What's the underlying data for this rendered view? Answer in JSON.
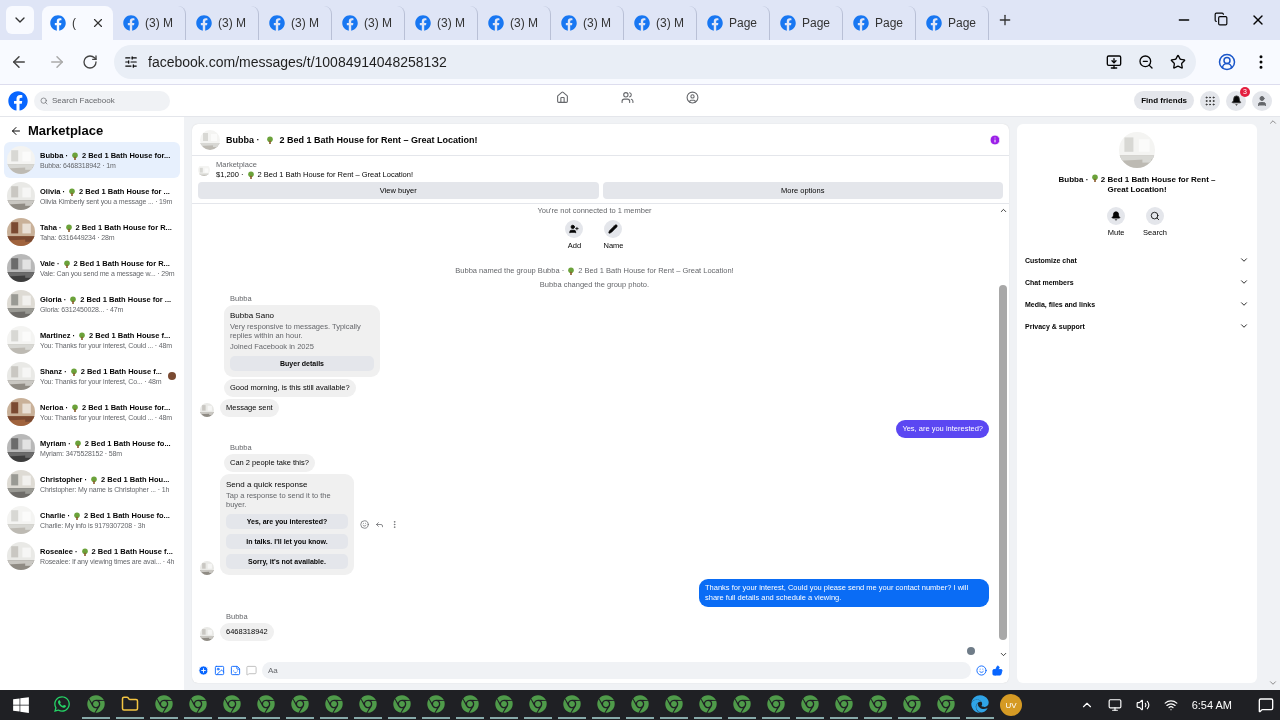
{
  "browser": {
    "tabs": [
      {
        "title": "(",
        "selected": true
      },
      {
        "title": "(3) M",
        "selected": false
      },
      {
        "title": "(3) M",
        "selected": false
      },
      {
        "title": "(3) M",
        "selected": false
      },
      {
        "title": "(3) M",
        "selected": false
      },
      {
        "title": "(3) M",
        "selected": false
      },
      {
        "title": "(3) M",
        "selected": false
      },
      {
        "title": "(3) M",
        "selected": false
      },
      {
        "title": "(3) M",
        "selected": false
      },
      {
        "title": "Page",
        "selected": false
      },
      {
        "title": "Page",
        "selected": false
      },
      {
        "title": "Page",
        "selected": false
      },
      {
        "title": "Page",
        "selected": false
      }
    ],
    "url": "facebook.com/messages/t/10084914048258132"
  },
  "header": {
    "search_placeholder": "Search Facebook",
    "find_friends": "Find friends",
    "notification_count": "3",
    "nav": [
      {
        "kind": "home"
      },
      {
        "kind": "friends"
      },
      {
        "kind": "groups"
      }
    ]
  },
  "sidebar": {
    "title": "Marketplace",
    "conversations": [
      {
        "name": "Bubba ·",
        "listing": "2 Bed 1 Bath House for...",
        "preview": "Bubba: 6468318942 · 1m",
        "selected": true,
        "seen": false
      },
      {
        "name": "Olivia ·",
        "listing": "2 Bed 1 Bath House for ...",
        "preview": "Olivia Kimberly sent you a message ... · 19m",
        "selected": false,
        "seen": false
      },
      {
        "name": "Taha ·",
        "listing": "2 Bed 1 Bath House for R...",
        "preview": "Taha: 6316449234 · 28m",
        "selected": false,
        "seen": false
      },
      {
        "name": "Vale ·",
        "listing": "2 Bed 1 Bath House for R...",
        "preview": "Vale: Can you send me a message w... · 29m",
        "selected": false,
        "seen": false
      },
      {
        "name": "Gloria ·",
        "listing": "2 Bed 1 Bath House for ...",
        "preview": "Gloria: 6312450028... · 47m",
        "selected": false,
        "seen": false
      },
      {
        "name": "Martinez ·",
        "listing": "2 Bed 1 Bath House f...",
        "preview": "You: Thanks for your interest, Could ... · 48m",
        "selected": false,
        "seen": false
      },
      {
        "name": "Shanz ·",
        "listing": "2 Bed 1 Bath House f...",
        "preview": "You: Thanks for your interest, Co... · 48m",
        "selected": false,
        "seen": true
      },
      {
        "name": "Nerioa ·",
        "listing": "2 Bed 1 Bath House for...",
        "preview": "You: Thanks for your interest, Could ... · 48m",
        "selected": false,
        "seen": false
      },
      {
        "name": "Myriam ·",
        "listing": "2 Bed 1 Bath House fo...",
        "preview": "Myriam: 3475528152 · 58m",
        "selected": false,
        "seen": false
      },
      {
        "name": "Christopher ·",
        "listing": "2 Bed 1 Bath Hou...",
        "preview": "Christopher: My name is Christopher ... · 1h",
        "selected": false,
        "seen": false
      },
      {
        "name": "Charlie ·",
        "listing": "2 Bed 1 Bath House fo...",
        "preview": "Charlie: My info is 9179307208 · 3h",
        "selected": false,
        "seen": false
      },
      {
        "name": "Rosealee ·",
        "listing": "2 Bed 1 Bath House f...",
        "preview": "Rosealee: If any viewing times are avai... · 4h",
        "selected": false,
        "seen": false
      }
    ]
  },
  "chat": {
    "name": "Bubba ·",
    "listing": "2 Bed 1 Bath House for Rent – Great Location!",
    "product": {
      "label": "Marketplace",
      "price": "$1,200 ·",
      "title": "2 Bed 1 Bath House for Rent – Great Location!"
    },
    "buttons": [
      "View buyer",
      "More options"
    ],
    "messages": [
      {
        "kind": "system",
        "text": "You're not connected to 1 member"
      },
      {
        "kind": "actions",
        "items": [
          {
            "label": "Add"
          },
          {
            "label": "Name"
          }
        ]
      },
      {
        "kind": "named",
        "text": "Bubba named the group Bubba ·",
        "listing": "2 Bed 1 Bath House for Rent – Great Location!"
      },
      {
        "kind": "system",
        "text": "Bubba changed the group photo."
      },
      {
        "kind": "profile",
        "sender": "Bubba",
        "name": "Bubba Sano",
        "lines": [
          "Very responsive to messages. Typically replies within an hour.",
          "Joined Facebook in 2025"
        ],
        "button": "Buyer details"
      },
      {
        "kind": "incoming",
        "text": "Good morning, is this still available?",
        "avatar": false
      },
      {
        "kind": "incoming",
        "text": "Message sent",
        "avatar": true
      },
      {
        "kind": "outgoing",
        "text": "Yes, are you interested?",
        "color": "#5b47f2"
      },
      {
        "kind": "incoming",
        "sender": "Bubba",
        "text": "Can 2 people take this?",
        "avatar": false
      },
      {
        "kind": "quick",
        "title": "Send a quick response",
        "hint": "Tap a response to send it to the buyer.",
        "options": [
          "Yes, are you interested?",
          "In talks. I'll let you know.",
          "Sorry, it's not available."
        ],
        "avatar": true
      },
      {
        "kind": "outgoing",
        "text": "Thanks for your interest, Could you please send me your contact number? I will share full details and schedule a viewing.",
        "color": "#0a6cf5"
      },
      {
        "kind": "incoming",
        "sender": "Bubba",
        "text": "6468318942",
        "avatar": true
      }
    ],
    "composer": {
      "placeholder": "Aa"
    }
  },
  "details": {
    "name": "Bubba ·",
    "listing": "2 Bed 1 Bath House for Rent – Great Location!",
    "actions": [
      {
        "label": "Mute"
      },
      {
        "label": "Search"
      }
    ],
    "sections": [
      {
        "label": "Customize chat",
        "expanded": false
      },
      {
        "label": "Chat members",
        "expanded": false
      },
      {
        "label": "Media, files and links",
        "expanded": false
      },
      {
        "label": "Privacy & support",
        "expanded": false
      }
    ]
  },
  "taskbar": {
    "apps": [
      {
        "kind": "whatsapp"
      },
      {
        "kind": "chrome"
      },
      {
        "kind": "folder"
      },
      {
        "kind": "chrome"
      },
      {
        "kind": "chrome"
      },
      {
        "kind": "chrome"
      },
      {
        "kind": "chrome"
      },
      {
        "kind": "chrome"
      },
      {
        "kind": "chrome"
      },
      {
        "kind": "chrome"
      },
      {
        "kind": "chrome"
      },
      {
        "kind": "chrome"
      },
      {
        "kind": "chrome"
      },
      {
        "kind": "chrome"
      },
      {
        "kind": "chrome"
      },
      {
        "kind": "chrome"
      },
      {
        "kind": "chrome"
      },
      {
        "kind": "chrome"
      },
      {
        "kind": "chrome"
      },
      {
        "kind": "chrome"
      },
      {
        "kind": "chrome"
      },
      {
        "kind": "chrome"
      },
      {
        "kind": "chrome"
      },
      {
        "kind": "chrome"
      },
      {
        "kind": "chrome"
      },
      {
        "kind": "chrome"
      },
      {
        "kind": "chrome"
      },
      {
        "kind": "edge"
      }
    ],
    "profile": "UV",
    "time": "6:54 AM"
  }
}
